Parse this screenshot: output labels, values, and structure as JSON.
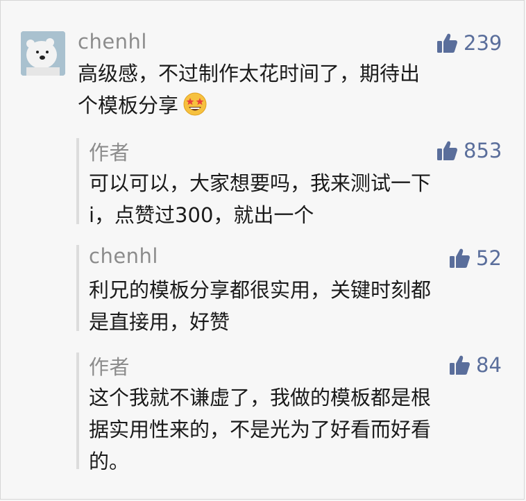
{
  "comment": {
    "author": "chenhl",
    "likes": "239",
    "lines": [
      "高级感，不过制作太花时间了，期待出",
      "个模板分享"
    ],
    "emoji_icon": "star-struck-emoji-icon"
  },
  "replies": [
    {
      "author": "作者",
      "likes": "853",
      "lines": [
        "可以可以，大家想要吗，我来测试一下",
        "i，点赞过300，就出一个"
      ]
    },
    {
      "author": "chenhl",
      "likes": "52",
      "lines": [
        "利兄的模板分享都很实用，关键时刻都",
        "是直接用，好赞"
      ]
    },
    {
      "author": "作者",
      "likes": "84",
      "lines": [
        "这个我就不谦虚了，我做的模板都是根",
        "据实用性来的，不是光为了好看而好看",
        "的。"
      ]
    }
  ],
  "colors": {
    "like_blue": "#5a6e9b",
    "author_gray": "#8c8c8c",
    "text": "#1a1a1a"
  }
}
